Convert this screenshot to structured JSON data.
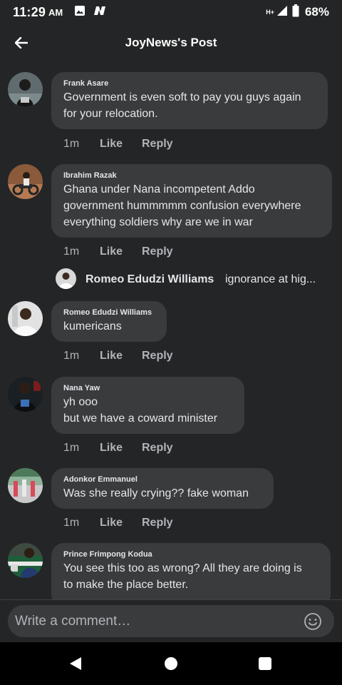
{
  "status_bar": {
    "time": "11:29",
    "ampm": "AM",
    "network": "H+",
    "battery": "68%",
    "icons": [
      "image-icon",
      "n-app-icon",
      "signal-icon",
      "battery-icon"
    ]
  },
  "header": {
    "title": "JoyNews's Post",
    "back_icon": "back-arrow-icon"
  },
  "comments": [
    {
      "author": "Frank Asare",
      "text": "Government is even soft to pay you guys again\nfor your relocation.",
      "time": "1m",
      "like": "Like",
      "reply": "Reply"
    },
    {
      "author": "Ibrahim Razak",
      "text": "Ghana under Nana incompetent Addo\ngovernment hummmmm confusion everywhere\neverything soldiers why are we in war",
      "time": "1m",
      "like": "Like",
      "reply": "Reply",
      "reply_preview": {
        "author": "Romeo Edudzi Williams",
        "snippet": "ignorance at hig..."
      }
    },
    {
      "author": "Romeo Edudzi Williams",
      "text": "kumericans",
      "time": "1m",
      "like": "Like",
      "reply": "Reply"
    },
    {
      "author": "Nana Yaw",
      "text": "yh ooo\nbut we have a coward minister",
      "time": "1m",
      "like": "Like",
      "reply": "Reply"
    },
    {
      "author": "Adonkor Emmanuel",
      "text": "Was she really crying?? fake woman",
      "time": "1m",
      "like": "Like",
      "reply": "Reply"
    },
    {
      "author": "Prince Frimpong Kodua",
      "text": "You see this too as wrong? All they are doing is\nto make the place better."
    }
  ],
  "composer": {
    "placeholder": "Write a comment…",
    "emoji_icon": "emoji-icon"
  },
  "nav_bar": {
    "icons": [
      "back-triangle-icon",
      "home-circle-icon",
      "recents-square-icon"
    ]
  },
  "colors": {
    "background": "#242526",
    "bubble": "#3a3b3c",
    "text": "#e4e6eb",
    "muted": "#b0b3b8",
    "nav_bar": "#000000"
  }
}
